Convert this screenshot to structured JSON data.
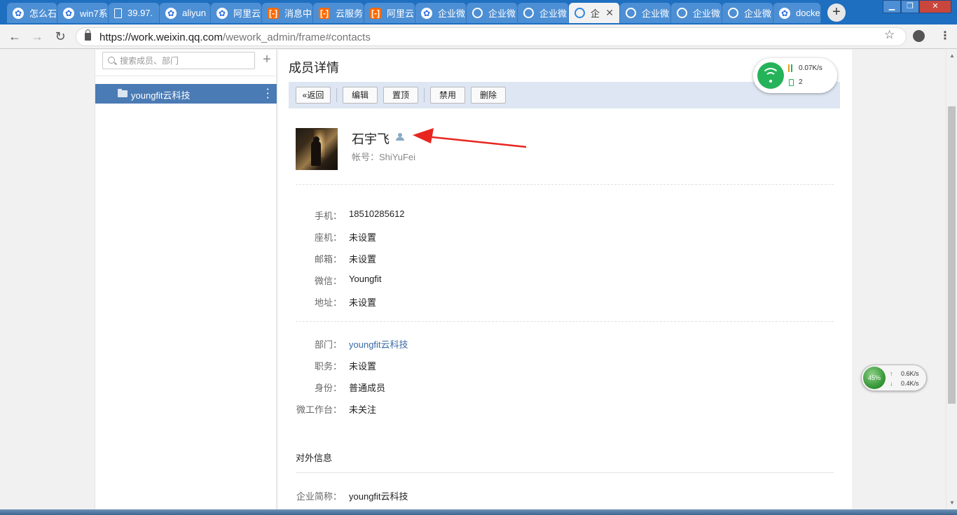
{
  "browser": {
    "tabs": [
      {
        "label": "怎么石",
        "icon": "baidu-paw-icon"
      },
      {
        "label": "win7系",
        "icon": "baidu-paw-icon"
      },
      {
        "label": "39.97.",
        "icon": "document-icon"
      },
      {
        "label": "aliyun",
        "icon": "baidu-paw-icon"
      },
      {
        "label": "阿里云",
        "icon": "baidu-paw-icon"
      },
      {
        "label": "消息中",
        "icon": "aliyun-icon"
      },
      {
        "label": "云服务",
        "icon": "aliyun-icon"
      },
      {
        "label": "阿里云",
        "icon": "aliyun-icon"
      },
      {
        "label": "企业微",
        "icon": "baidu-paw-icon"
      },
      {
        "label": "企业微",
        "icon": "wework-icon"
      },
      {
        "label": "企业微",
        "icon": "wework-icon"
      },
      {
        "label": "企",
        "icon": "wework-icon",
        "active": true
      },
      {
        "label": "企业微",
        "icon": "wework-icon"
      },
      {
        "label": "企业微",
        "icon": "wework-icon"
      },
      {
        "label": "企业微",
        "icon": "wework-icon"
      },
      {
        "label": "docke",
        "icon": "baidu-paw-icon"
      }
    ],
    "url_host": "https://work.weixin.qq.com",
    "url_path": "/wework_admin/frame#contacts"
  },
  "sidebar": {
    "search_placeholder": "搜索成员、部门",
    "departments": [
      {
        "label": "youngfit云科技"
      }
    ]
  },
  "main": {
    "title": "成员详情",
    "toolbar": {
      "back_label": "返回",
      "edit_label": "编辑",
      "pin_label": "置顶",
      "disable_label": "禁用",
      "delete_label": "删除"
    },
    "profile": {
      "name": "石宇飞",
      "account": "帐号：ShiYuFei"
    },
    "contact_fields": [
      {
        "label": "手机：",
        "value": "18510285612"
      },
      {
        "label": "座机：",
        "value": "未设置"
      },
      {
        "label": "邮箱：",
        "value": "未设置"
      },
      {
        "label": "微信：",
        "value": "Youngfit"
      },
      {
        "label": "地址：",
        "value": "未设置"
      }
    ],
    "org_fields": [
      {
        "label": "部门：",
        "value": "youngfit云科技"
      },
      {
        "label": "职务：",
        "value": "未设置"
      },
      {
        "label": "身份：",
        "value": "普通成员"
      },
      {
        "label": "微工作台：",
        "value": "未关注"
      }
    ],
    "external_title": "对外信息",
    "external_fields": [
      {
        "label": "企业简称：",
        "value": "youngfit云科技"
      }
    ]
  },
  "widgets": {
    "network_speed": "0.07K/s",
    "device_count": "2",
    "cpu_percent": "45%",
    "upload": "0.6K/s",
    "download": "0.4K/s"
  },
  "colors": {
    "tabbar": "#1e6fc0",
    "sidebar_selected": "#4a7bb4",
    "toolbar_bg": "#dde6f2",
    "link": "#3a6aa8",
    "annotation_arrow": "#e8251f"
  }
}
